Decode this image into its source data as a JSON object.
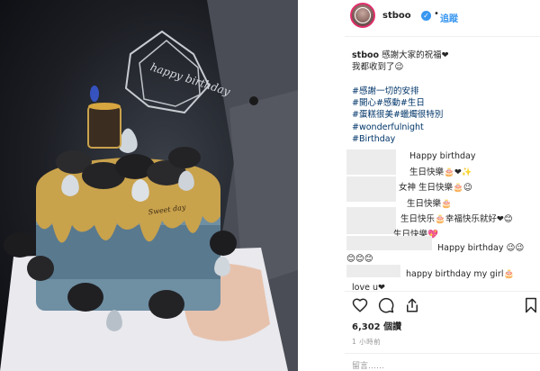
{
  "post": {
    "username": "stboo",
    "verified_mark": "✓",
    "separator": "•",
    "follow_label": "追蹤",
    "caption_user": "stboo",
    "caption_line1": "感謝大家的祝福❤",
    "caption_line2": "我都收到了😉",
    "hashtags": [
      "#感謝一切的安排",
      "#開心#感動#生日",
      "#蛋糕很美#蠟燭很特別",
      "#wonderfulnight",
      "#Birthday"
    ]
  },
  "photo": {
    "topper_text": "happy birthday",
    "plaque_text": "Sweet day"
  },
  "comments": [
    {
      "text": "Happy birthday"
    },
    {
      "text": "生日快樂🎂❤✨"
    },
    {
      "text": "女神 生日快樂🎂😉"
    },
    {
      "text": "生日快樂🎂"
    },
    {
      "text": "生日快乐🎂幸福快乐就好❤😊"
    },
    {
      "text": "生日快樂💖"
    },
    {
      "text": "Happy birthday 😉😉"
    },
    {
      "text": "😊😊😊"
    },
    {
      "text": "happy birthday my girl🎂"
    },
    {
      "text": "love u❤"
    }
  ],
  "actions": {
    "like_icon": "heart-icon",
    "comment_icon": "comment-icon",
    "share_icon": "share-icon",
    "save_icon": "bookmark-icon",
    "likes_text": "6,302 個讚",
    "time_text": "1 小時前",
    "add_comment_placeholder": "留言……"
  },
  "colors": {
    "link": "#003569",
    "follow": "#3897f0",
    "verified": "#3897f0",
    "muted": "#999999"
  }
}
